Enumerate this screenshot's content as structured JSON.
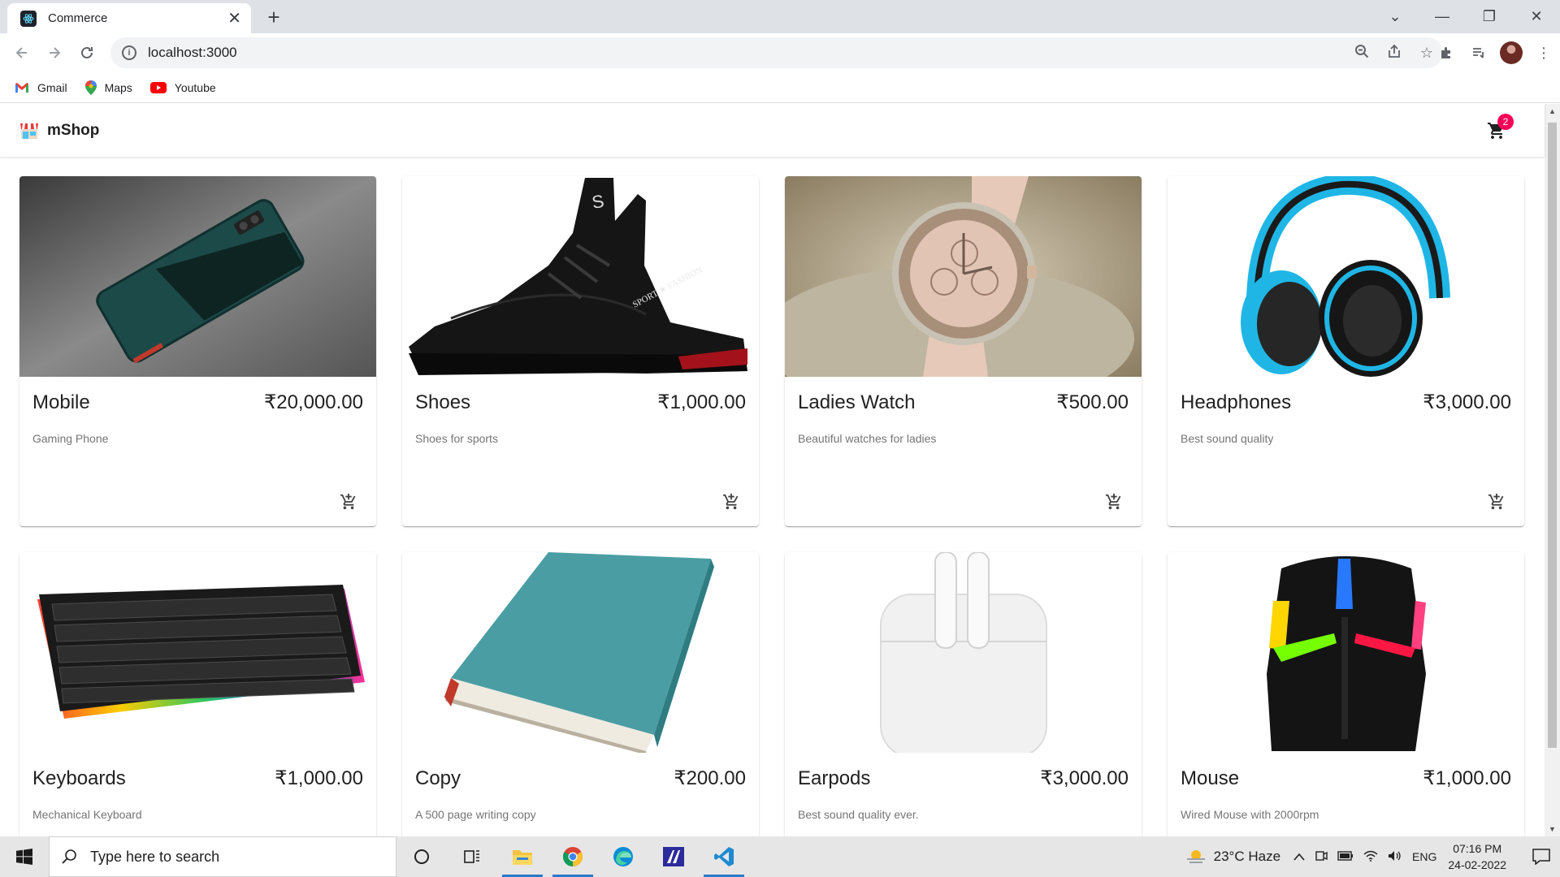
{
  "browser": {
    "tab_title": "Commerce",
    "url": "localhost:3000",
    "bookmarks": [
      {
        "label": "Gmail",
        "icon": "gmail-icon"
      },
      {
        "label": "Maps",
        "icon": "maps-icon"
      },
      {
        "label": "Youtube",
        "icon": "youtube-icon"
      }
    ]
  },
  "app": {
    "brand": "mShop",
    "cart_count": "2",
    "accent": "#f50057"
  },
  "products": [
    {
      "name": "Mobile",
      "price": "₹20,000.00",
      "description": "Gaming Phone",
      "image": "phone"
    },
    {
      "name": "Shoes",
      "price": "₹1,000.00",
      "description": "Shoes for sports",
      "image": "shoe"
    },
    {
      "name": "Ladies Watch",
      "price": "₹500.00",
      "description": "Beautiful watches for ladies",
      "image": "watch"
    },
    {
      "name": "Headphones",
      "price": "₹3,000.00",
      "description": "Best sound quality",
      "image": "headphones"
    },
    {
      "name": "Keyboards",
      "price": "₹1,000.00",
      "description": "Mechanical Keyboard",
      "image": "keyboard"
    },
    {
      "name": "Copy",
      "price": "₹200.00",
      "description": "A 500 page writing copy",
      "image": "book"
    },
    {
      "name": "Earpods",
      "price": "₹3,000.00",
      "description": "Best sound quality ever.",
      "image": "earpods"
    },
    {
      "name": "Mouse",
      "price": "₹1,000.00",
      "description": "Wired Mouse with 2000rpm",
      "image": "mouse"
    }
  ],
  "taskbar": {
    "search_placeholder": "Type here to search",
    "weather": "23°C  Haze",
    "language": "ENG",
    "time": "07:16 PM",
    "date": "24-02-2022"
  }
}
